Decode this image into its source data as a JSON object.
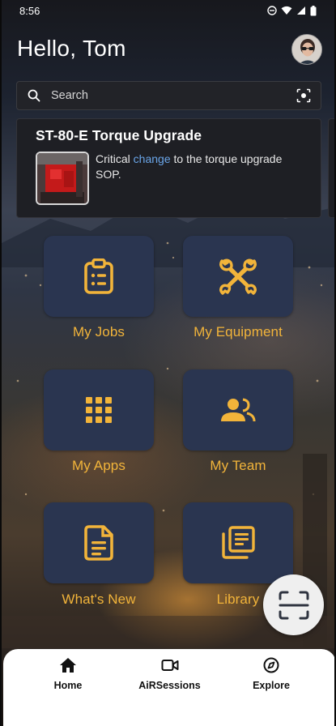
{
  "status_bar": {
    "time": "8:56"
  },
  "header": {
    "greeting": "Hello, Tom"
  },
  "search": {
    "placeholder": "Search"
  },
  "news_card": {
    "title": "ST-80-E Torque Upgrade",
    "text_before": "Critical ",
    "link_text": "change",
    "text_after": " to the torque upgrade SOP."
  },
  "tiles": [
    {
      "label": "My Jobs",
      "icon": "clipboard-list-icon"
    },
    {
      "label": "My Equipment",
      "icon": "wrench-cross-icon"
    },
    {
      "label": "My Apps",
      "icon": "app-grid-icon"
    },
    {
      "label": "My  Team",
      "icon": "team-icon"
    },
    {
      "label": "What's New",
      "icon": "document-icon"
    },
    {
      "label": "Library",
      "icon": "library-icon"
    }
  ],
  "bottom_nav": [
    {
      "label": "Home",
      "icon": "home-icon"
    },
    {
      "label": "AiRSessions",
      "icon": "video-camera-icon"
    },
    {
      "label": "Explore",
      "icon": "compass-icon"
    }
  ],
  "colors": {
    "accent": "#f2b43a",
    "tile_bg": "#2a3550",
    "link": "#6aa5e8"
  }
}
